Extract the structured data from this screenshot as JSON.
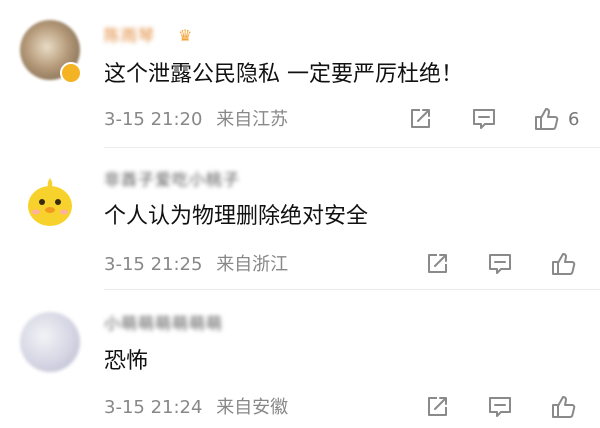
{
  "comments": [
    {
      "username": "陈雨琴",
      "text": "这个泄露公民隐私 一定要严厉杜绝！",
      "time": "3-15 21:20",
      "location": "来自江苏",
      "like_count": "6"
    },
    {
      "username": "非酋子爱吃小桃子",
      "text": "个人认为物理删除绝对安全",
      "time": "3-15 21:25",
      "location": "来自浙江"
    },
    {
      "username": "小萌萌萌萌萌萌",
      "text": "恐怖",
      "time": "3-15 21:24",
      "location": "来自安徽"
    }
  ],
  "icons": {
    "share": "share-icon",
    "comment": "comment-icon",
    "like": "thumbs-up-icon",
    "vip": "vip-badge-icon",
    "crown": "crown-icon"
  },
  "colors": {
    "vip_name": "#e0883a",
    "meta_text": "#888888",
    "icon": "#8a8a8a"
  }
}
